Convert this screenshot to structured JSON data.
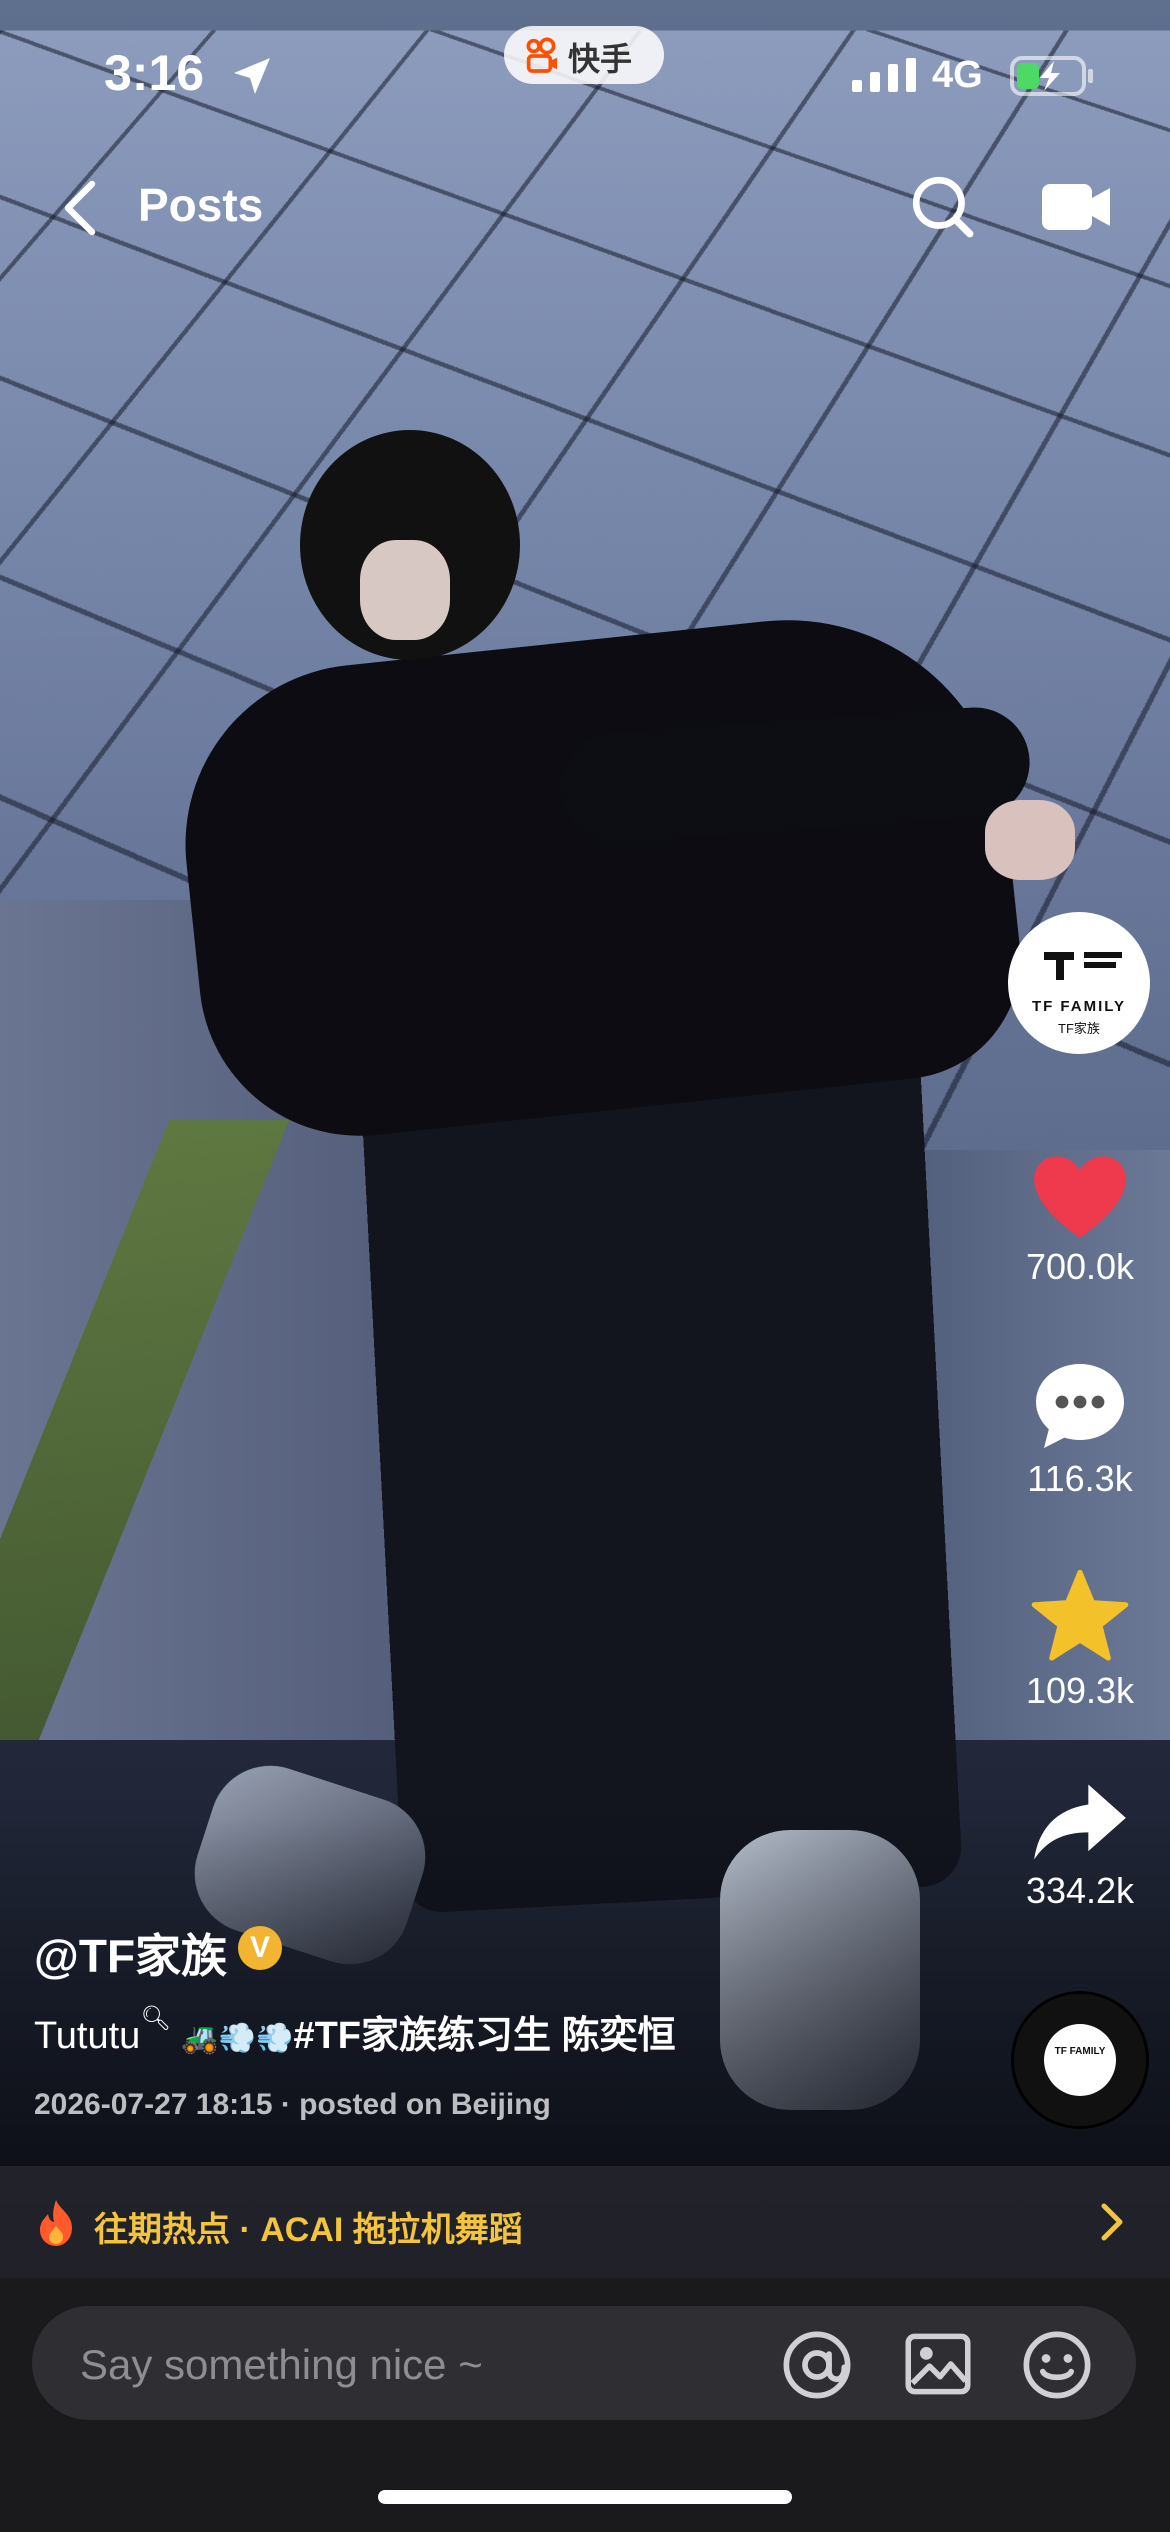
{
  "status_bar": {
    "time": "3:16",
    "app_badge": "快手",
    "network": "4G",
    "icons": [
      "location-arrow-icon",
      "signal-icon",
      "battery-charging-icon"
    ]
  },
  "nav": {
    "back_icon": "chevron-left-icon",
    "title": "Posts",
    "search_icon": "search-icon",
    "camera_icon": "camera-icon"
  },
  "profile_avatar": {
    "logo_text": "TF FAMILY",
    "sub_text": "TF家族"
  },
  "actions": {
    "likes": "700.0k",
    "comments": "116.3k",
    "favorites": "109.3k",
    "shares": "334.2k"
  },
  "music_disc": {
    "text": "TF FAMILY"
  },
  "post": {
    "author": "@TF家族",
    "verified_badge": "V",
    "caption_prefix": "Tututu",
    "caption_hashtag": "#TF家族练习生",
    "caption_name": "陈奕恒",
    "meta": "2026-07-27 18:15 · posted on Beijing"
  },
  "hot_topic": {
    "label": "往期热点 · ACAI 拖拉机舞蹈"
  },
  "comment_bar": {
    "placeholder": "Say something nice ~"
  },
  "colors": {
    "like_red": "#ee3a4c",
    "star_gold": "#f3c129",
    "hot_gold": "#f4c43c",
    "verified_gold": "#f2b431",
    "kuaishou_orange": "#ff5000"
  }
}
